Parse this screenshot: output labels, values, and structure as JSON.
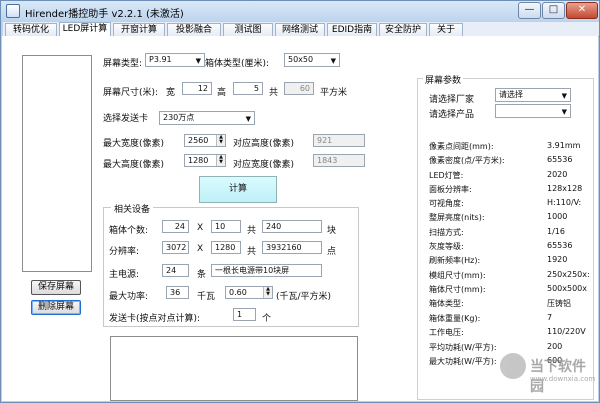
{
  "app": {
    "title": "Hirender播控助手 v2.2.1 (未激活)"
  },
  "window_controls": {
    "minimize": "—",
    "maximize": "□",
    "close": "✕"
  },
  "tabs": [
    "转码优化",
    "LED屏计算",
    "开窗计算",
    "投影融合",
    "测试图",
    "网络测试",
    "EDID指南",
    "安全防护",
    "关于"
  ],
  "sidebar": {
    "save": "保存屏幕",
    "delete": "删除屏幕"
  },
  "form": {
    "screen_type_label": "屏幕类型:",
    "screen_type_value": "P3.91",
    "cabinet_type_label": "箱体类型(厘米):",
    "cabinet_type_value": "50x50",
    "screen_size_label": "屏幕尺寸(米):",
    "w_label": "宽",
    "w_value": "12",
    "h_label": "高",
    "h_value": "5",
    "total_label": "共",
    "total_value": "60",
    "unit_sqm": "平方米",
    "card_label": "选择发送卡",
    "card_value": "230万点",
    "max_w_label": "最大宽度(像素)",
    "max_w_value": "2560",
    "corr_h_label": "对应高度(像素)",
    "corr_h_value": "921",
    "max_h_label": "最大高度(像素)",
    "max_h_value": "1280",
    "corr_w_label": "对应宽度(像素)",
    "corr_w_value": "1843",
    "calc_button": "计算"
  },
  "group": {
    "title": "相关设备",
    "cab_label": "箱体个数:",
    "cab_a": "24",
    "x": "X",
    "cab_b": "10",
    "gong": "共",
    "cab_total": "240",
    "cab_unit": "块",
    "res_label": "分辨率:",
    "res_a": "3072",
    "res_b": "1280",
    "res_total": "3932160",
    "res_unit": "点",
    "power_label": "主电源:",
    "power_value": "24",
    "power_unit": "条",
    "power_note": "一根长电源带10块屏",
    "max_power_label": "最大功率:",
    "max_power_value": "36",
    "kw": "千瓦",
    "max_power_coef": "0.60",
    "kw_unit": "(千瓦/平方米)",
    "card_count_label": "发送卡(按点对点计算):",
    "card_count_value": "1",
    "card_count_unit": "个"
  },
  "params": {
    "title": "屏幕参数",
    "vendor_label": "请选择厂家",
    "vendor_value": "请选择",
    "product_label": "请选择产品",
    "product_value": "",
    "rows": [
      {
        "label": "像素点间距(mm):",
        "value": "3.91mm"
      },
      {
        "label": "像素密度(点/平方米):",
        "value": "65536"
      },
      {
        "label": "LED灯管:",
        "value": "2020"
      },
      {
        "label": "面板分辨率:",
        "value": "128x128"
      },
      {
        "label": "可视角度:",
        "value": "H:110/V:"
      },
      {
        "label": "整屏亮度(nits):",
        "value": "1000"
      },
      {
        "label": "扫描方式:",
        "value": "1/16"
      },
      {
        "label": "灰度等级:",
        "value": "65536"
      },
      {
        "label": "刷新频率(Hz):",
        "value": "1920"
      },
      {
        "label": "模组尺寸(mm):",
        "value": "250x250x:"
      },
      {
        "label": "箱体尺寸(mm):",
        "value": "500x500x"
      },
      {
        "label": "箱体类型:",
        "value": "压铸铝"
      },
      {
        "label": "箱体重量(Kg):",
        "value": "7"
      },
      {
        "label": "工作电压:",
        "value": "110/220V"
      },
      {
        "label": "平均功耗(W/平方):",
        "value": "200"
      },
      {
        "label": "最大功耗(W/平方):",
        "value": "600"
      }
    ]
  },
  "watermark": {
    "text": "当下软件园",
    "url": "www.downxia.com"
  }
}
